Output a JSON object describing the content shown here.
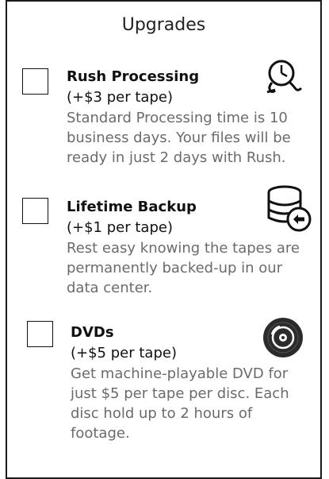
{
  "panel": {
    "title": "Upgrades"
  },
  "upgrades": [
    {
      "name": "Rush Processing",
      "price": "(+$3 per tape)",
      "desc_lines": [
        "Standard Processing time is 10",
        "business days. Your files will be",
        "ready in just 2 days with Rush."
      ],
      "icon": "stopwatch-icon",
      "checked": false
    },
    {
      "name": "Lifetime Backup",
      "price": "(+$1 per tape)",
      "desc_lines": [
        "Rest easy knowing the tapes are",
        "permanently backed-up in our",
        "data center."
      ],
      "icon": "database-backup-icon",
      "checked": false
    },
    {
      "name": "DVDs",
      "price": "(+$5 per tape)",
      "desc_lines": [
        "Get machine-playable DVD for",
        "just $5 per tape per disc.  Each",
        "disc hold up to 2 hours of",
        "footage."
      ],
      "icon": "disc-icon",
      "checked": false
    }
  ]
}
